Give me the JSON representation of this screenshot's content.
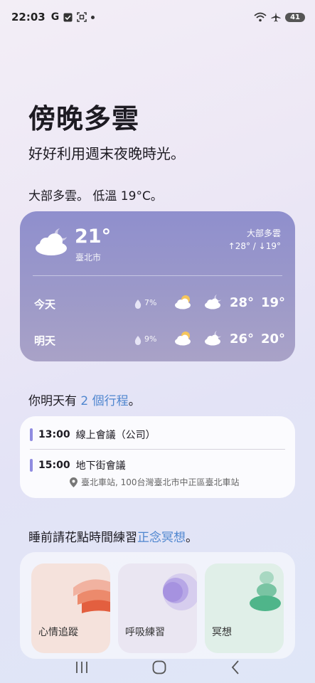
{
  "status_bar": {
    "time": "22:03",
    "g_label": "G",
    "battery": "41"
  },
  "headline": "傍晚多雲",
  "subhead": "好好利用週末夜晚時光。",
  "weather_summary": "大部多雲。 低溫 19°C。",
  "weather": {
    "current_temp": "21°",
    "location": "臺北市",
    "condition": "大部多雲",
    "hi_lo": "↑28° / ↓19°",
    "days": [
      {
        "label": "今天",
        "precip": "7%",
        "high": "28°",
        "low": "19°",
        "icon_day": "partly-sunny-icon",
        "icon_night": "partly-cloudy-night-icon"
      },
      {
        "label": "明天",
        "precip": "9%",
        "high": "26°",
        "low": "20°",
        "icon_day": "partly-sunny-icon",
        "icon_night": "partly-cloudy-night-icon"
      }
    ]
  },
  "schedule": {
    "prefix": "你明天有 ",
    "count": "2 個行程",
    "suffix": "。",
    "events": [
      {
        "time": "13:00",
        "title": "線上會議（公司）"
      },
      {
        "time": "15:00",
        "title": "地下街會議",
        "location": "臺北車站, 100台灣臺北市中正區臺北車站"
      }
    ]
  },
  "meditation": {
    "prefix": "睡前請花點時間練習",
    "highlight": "正念冥想",
    "suffix": "。",
    "tiles": [
      "心情追蹤",
      "呼吸練習",
      "冥想"
    ]
  },
  "colors": {
    "accent": "#4f86cf",
    "event_bar": "#8f8be0",
    "weather_card": "#9c99c9"
  }
}
